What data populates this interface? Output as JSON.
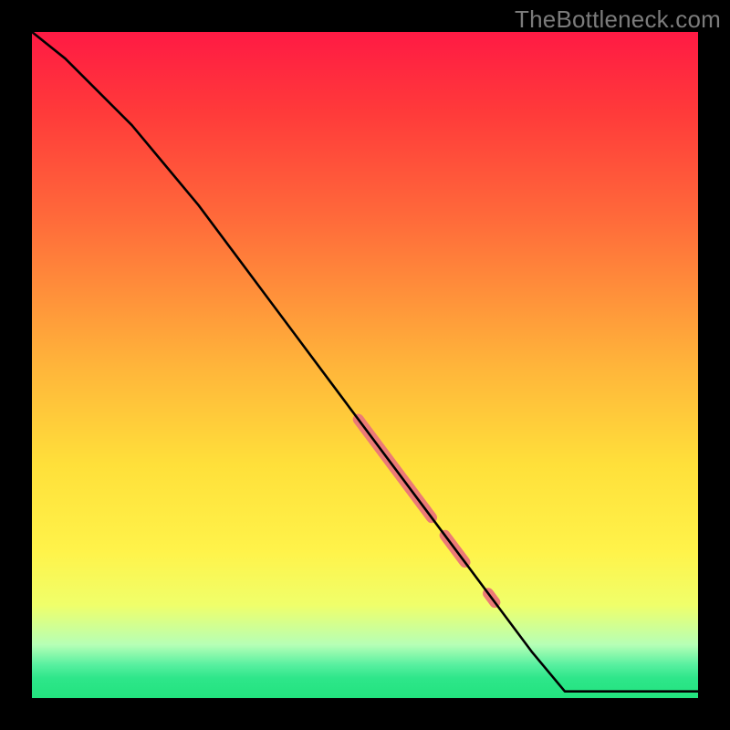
{
  "watermark": "TheBottleneck.com",
  "chart_data": {
    "type": "line",
    "title": "",
    "xlabel": "",
    "ylabel": "",
    "xlim": [
      0,
      100
    ],
    "ylim": [
      0,
      100
    ],
    "grid": false,
    "legend": false,
    "series": [
      {
        "name": "primary-curve",
        "color": "#000000",
        "x": [
          0,
          5,
          10,
          15,
          20,
          25,
          30,
          35,
          40,
          45,
          50,
          55,
          60,
          65,
          70,
          75,
          80,
          85,
          90,
          95,
          100
        ],
        "y": [
          100,
          96,
          91,
          86,
          80,
          74,
          67.3,
          60.6,
          53.9,
          47.2,
          40.5,
          33.8,
          27.1,
          20.4,
          13.7,
          7.0,
          1.0,
          1.0,
          1.0,
          1.0,
          1.0
        ]
      }
    ],
    "highlight_segments": [
      {
        "name": "band-a",
        "x0": 49,
        "x1": 60,
        "color": "#ec7a76",
        "width": 12
      },
      {
        "name": "band-b",
        "x0": 62,
        "x1": 65,
        "color": "#ec7a76",
        "width": 12
      },
      {
        "name": "dot-c",
        "x0": 68.5,
        "x1": 69.5,
        "color": "#ec7a76",
        "width": 12
      }
    ]
  }
}
